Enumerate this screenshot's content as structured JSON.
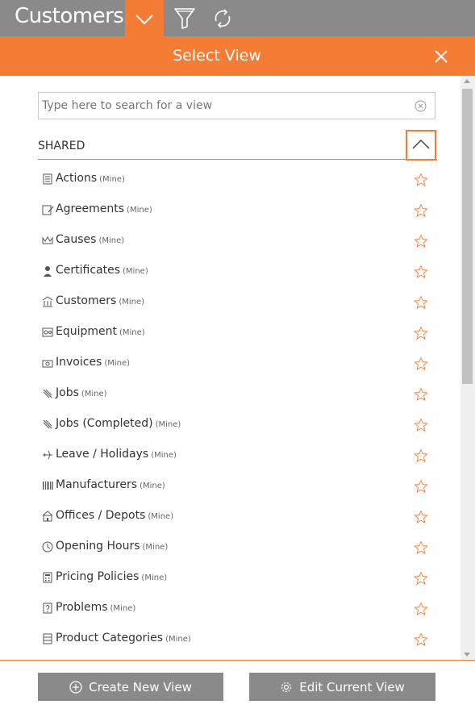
{
  "topbar": {
    "title": "Customers"
  },
  "panel": {
    "title": "Select View"
  },
  "search": {
    "placeholder": "Type here to search for a view"
  },
  "section": {
    "label": "SHARED"
  },
  "items": [
    {
      "label": "Actions",
      "tag": "(Mine)",
      "icon": "stack-icon"
    },
    {
      "label": "Agreements",
      "tag": "(Mine)",
      "icon": "document-pen-icon"
    },
    {
      "label": "Causes",
      "tag": "(Mine)",
      "icon": "crown-icon"
    },
    {
      "label": "Certificates",
      "tag": "(Mine)",
      "icon": "person-icon"
    },
    {
      "label": "Customers",
      "tag": "(Mine)",
      "icon": "bank-icon"
    },
    {
      "label": "Equipment",
      "tag": "(Mine)",
      "icon": "equipment-icon"
    },
    {
      "label": "Invoices",
      "tag": "(Mine)",
      "icon": "invoice-icon"
    },
    {
      "label": "Jobs",
      "tag": "(Mine)",
      "icon": "tools-icon"
    },
    {
      "label": "Jobs (Completed)",
      "tag": "(Mine)",
      "icon": "tools-icon"
    },
    {
      "label": "Leave / Holidays",
      "tag": "(Mine)",
      "icon": "plane-icon"
    },
    {
      "label": "Manufacturers",
      "tag": "(Mine)",
      "icon": "barcode-icon"
    },
    {
      "label": "Offices / Depots",
      "tag": "(Mine)",
      "icon": "building-icon"
    },
    {
      "label": "Opening Hours",
      "tag": "(Mine)",
      "icon": "clock-icon"
    },
    {
      "label": "Pricing Policies",
      "tag": "(Mine)",
      "icon": "calculator-icon"
    },
    {
      "label": "Problems",
      "tag": "(Mine)",
      "icon": "question-icon"
    },
    {
      "label": "Product Categories",
      "tag": "(Mine)",
      "icon": "box-icon"
    }
  ],
  "footer": {
    "create_label": "Create New View",
    "edit_label": "Edit Current View"
  },
  "colors": {
    "accent": "#f57c35",
    "header_gray": "#8a8a8a",
    "star": "#f57c35"
  }
}
